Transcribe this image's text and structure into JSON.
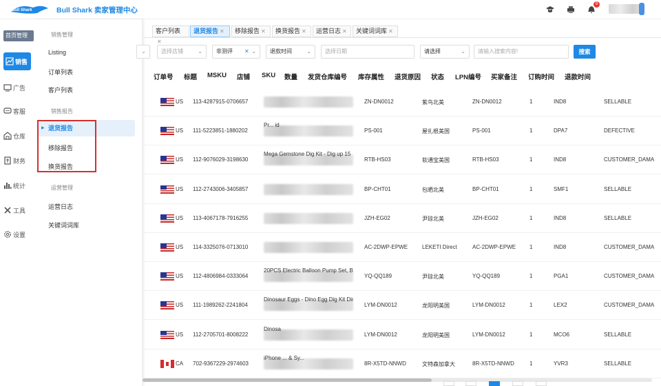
{
  "header": {
    "logo_text": "Bull Shark",
    "title": "Bull Shark 卖家管理中心",
    "notification_count": "9"
  },
  "leftnav": {
    "home_label": "首页管理",
    "items": [
      {
        "label": "销售",
        "icon": "chart-icon"
      },
      {
        "label": "广告",
        "icon": "ad-icon"
      },
      {
        "label": "客服",
        "icon": "chat-icon"
      },
      {
        "label": "仓库",
        "icon": "warehouse-icon"
      },
      {
        "label": "财务",
        "icon": "finance-icon"
      },
      {
        "label": "统计",
        "icon": "bar-chart-icon"
      },
      {
        "label": "工具",
        "icon": "tools-icon"
      },
      {
        "label": "设置",
        "icon": "gear-icon"
      }
    ]
  },
  "subnav": {
    "group1": "销售管理",
    "listing": "Listing",
    "orders": "订单列表",
    "customers": "客户列表",
    "group2": "销售报告",
    "returns": "退货报告",
    "removals": "移除报告",
    "exchanges": "换货报告",
    "group3": "运营管理",
    "ops_log": "运营日志",
    "keywords": "关键词词库"
  },
  "tabs": [
    "客户列表",
    "退货报告",
    "移除报告",
    "换货报告",
    "运营日志",
    "关键词词库"
  ],
  "filters": {
    "store": "选择店铺",
    "test": "非测评",
    "return_time": "退款时间",
    "date": "选择日期",
    "select": "请选择",
    "search_placeholder": "请输入搜索内容!",
    "search_button": "搜索"
  },
  "table": {
    "headers": [
      "订单号",
      "标题",
      "MSKU",
      "店铺",
      "SKU",
      "数量",
      "发货仓库编号",
      "库存属性",
      "退货原因",
      "状态",
      "LPN编号",
      "买家备注",
      "订购时间",
      "退款时间"
    ],
    "rows": [
      {
        "country": "US",
        "order": "113-4287915-0706657",
        "title": "",
        "msku": "ZN-DN0012",
        "store": "紫鸟北美",
        "sku": "ZN-DN0012",
        "qty": "1",
        "wh": "IND8",
        "reason": "SELLABLE"
      },
      {
        "country": "US",
        "order": "111-5223851-1880202",
        "title": "Pr... id",
        "msku": "PS-001",
        "store": "屋扎根美国",
        "sku": "PS-001",
        "qty": "1",
        "wh": "DPA7",
        "reason": "DEFECTIVE"
      },
      {
        "country": "US",
        "order": "112-9076029-3198630",
        "title": "Mega Gemstone Dig Kit - Dig up 15",
        "msku": "RTB-HS03",
        "store": "软通宝美国",
        "sku": "RTB-HS03",
        "qty": "1",
        "wh": "IND8",
        "reason": "CUSTOMER_DAMA"
      },
      {
        "country": "US",
        "order": "112-2743006-3405857",
        "title": "",
        "msku": "BP-CHT01",
        "store": "包晒北美",
        "sku": "BP-CHT01",
        "qty": "1",
        "wh": "SMF1",
        "reason": "SELLABLE"
      },
      {
        "country": "US",
        "order": "113-4067178-7916255",
        "title": "",
        "msku": "JZH-EG02",
        "store": "尹琼北美",
        "sku": "JZH-EG02",
        "qty": "1",
        "wh": "IND8",
        "reason": "SELLABLE"
      },
      {
        "country": "US",
        "order": "114-3325076-0713010",
        "title": "",
        "msku": "AC-2DWP-EPWE",
        "store": "LEKETI Direct",
        "sku": "AC-2DWP-EPWE",
        "qty": "1",
        "wh": "IND8",
        "reason": "CUSTOMER_DAMA"
      },
      {
        "country": "US",
        "order": "112-4806984-0333064",
        "title": "20PCS Electric Balloon Pump Set, Bal",
        "msku": "YQ-QQ189",
        "store": "尹琼北美",
        "sku": "YQ-QQ189",
        "qty": "1",
        "wh": "PGA1",
        "reason": "CUSTOMER_DAMA"
      },
      {
        "country": "US",
        "order": "111-1989262-2241804",
        "title": "Dinosaur Eggs - Dino Egg Dig Kit Din",
        "msku": "LYM-DN0012",
        "store": "龙阳明美国",
        "sku": "LYM-DN0012",
        "qty": "1",
        "wh": "LEX2",
        "reason": "CUSTOMER_DAMA"
      },
      {
        "country": "US",
        "order": "112-2705701-8008222",
        "title": "Dinosa",
        "msku": "LYM-DN0012",
        "store": "龙阳明美国",
        "sku": "LYM-DN0012",
        "qty": "1",
        "wh": "MCO6",
        "reason": "SELLABLE"
      },
      {
        "country": "CA",
        "order": "702-9367229-2974603",
        "title": "iPhone ... & Sy...",
        "msku": "8R-X5TD-NNWD",
        "store": "文特森加拿大",
        "sku": "8R-X5TD-NNWD",
        "qty": "1",
        "wh": "YVR3",
        "reason": "SELLABLE"
      }
    ]
  }
}
